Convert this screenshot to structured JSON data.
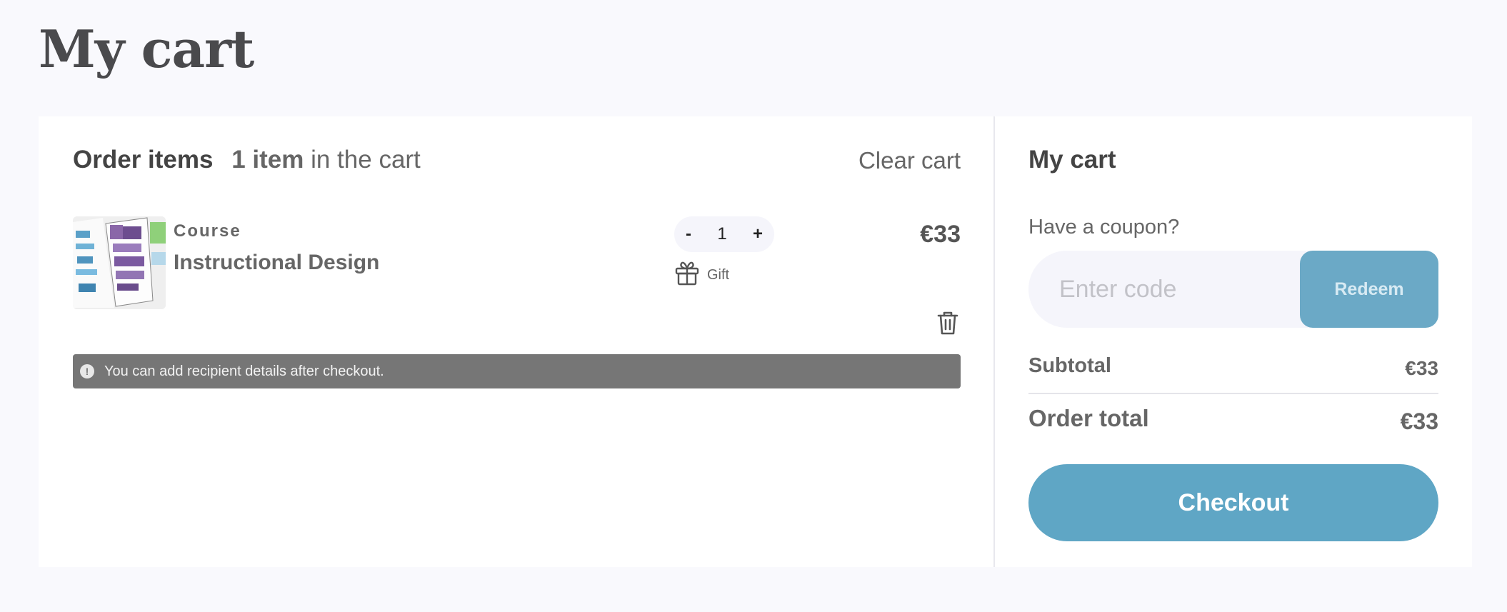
{
  "page": {
    "title": "My cart"
  },
  "order": {
    "heading": "Order items",
    "count_bold": "1 item",
    "count_rest": "in the cart",
    "clear_label": "Clear cart"
  },
  "items": [
    {
      "type": "Course",
      "name": "Instructional Design",
      "quantity": "1",
      "minus": "-",
      "plus": "+",
      "gift_label": "Gift",
      "price": "€33"
    }
  ],
  "notice": {
    "text": "You can add recipient details after checkout.",
    "icon": "!"
  },
  "summary": {
    "title": "My cart",
    "coupon_label": "Have a coupon?",
    "coupon_placeholder": "Enter code",
    "coupon_value": "",
    "redeem_label": "Redeem",
    "subtotal_label": "Subtotal",
    "subtotal_value": "€33",
    "total_label": "Order total",
    "total_value": "€33",
    "checkout_label": "Checkout"
  },
  "colors": {
    "accent": "#5fa6c5",
    "redeem_bg": "#6ba9c6",
    "notice_bg": "#767676",
    "page_bg": "#f9f9fd"
  },
  "icons": {
    "gift": "gift-icon",
    "trash": "trash-icon",
    "notice": "exclamation-circle-icon"
  }
}
